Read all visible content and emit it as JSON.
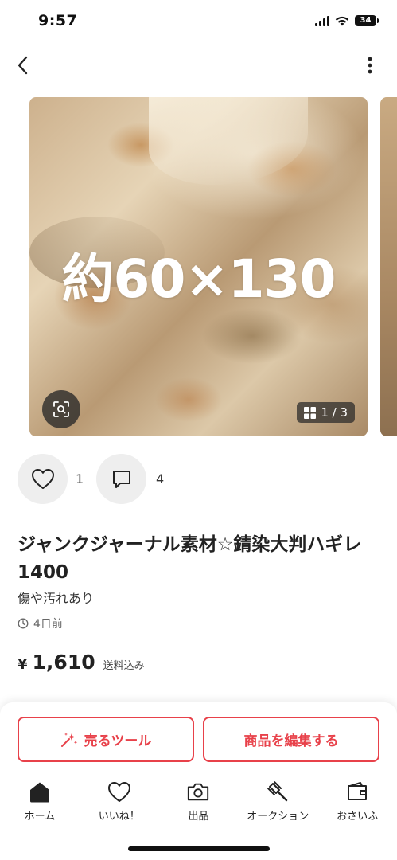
{
  "status_bar": {
    "time": "9:57",
    "battery": "34"
  },
  "listing": {
    "overlay_text": "約60×130",
    "image_counter": "1 / 3",
    "likes": "1",
    "comments": "4",
    "title": "ジャンクジャーナル素材☆錆染大判ハギレ1400",
    "condition": "傷や汚れあり",
    "posted": "4日前",
    "price_symbol": "¥",
    "price": "1,610",
    "shipping_note": "送料込み"
  },
  "actions": {
    "sell_tool_label": "売るツール",
    "edit_label": "商品を編集する"
  },
  "tabbar": {
    "items": [
      {
        "label": "ホーム",
        "icon": "home-icon"
      },
      {
        "label": "いいね！",
        "icon": "heart-icon"
      },
      {
        "label": "出品",
        "icon": "camera-icon"
      },
      {
        "label": "オークション",
        "icon": "auction-hammer-icon"
      },
      {
        "label": "おさいふ",
        "icon": "wallet-icon"
      }
    ]
  },
  "colors": {
    "accent": "#e8414a",
    "text": "#222222"
  }
}
